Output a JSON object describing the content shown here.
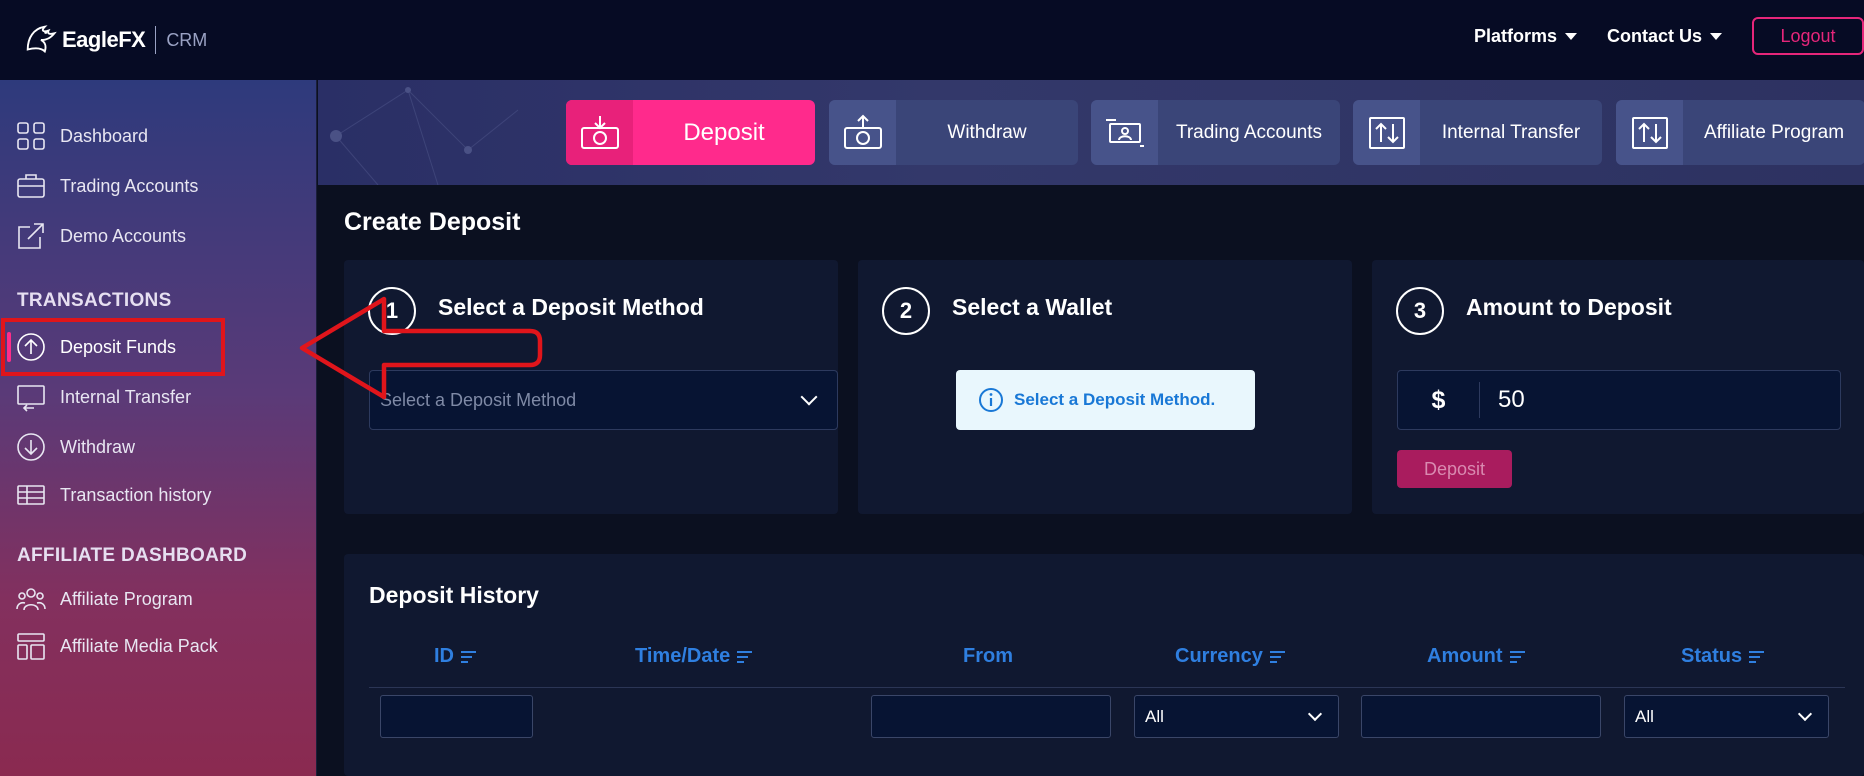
{
  "header": {
    "logo_text": "EagleFX",
    "logo_suffix": "CRM",
    "nav": [
      {
        "label": "Platforms"
      },
      {
        "label": "Contact Us"
      }
    ],
    "logout_label": "Logout"
  },
  "sidebar": {
    "items_top": [
      {
        "label": "Dashboard",
        "icon": "grid-icon"
      },
      {
        "label": "Trading Accounts",
        "icon": "briefcase-icon"
      },
      {
        "label": "Demo Accounts",
        "icon": "share-out-icon"
      }
    ],
    "transactions_heading": "TRANSACTIONS",
    "transactions": [
      {
        "label": "Deposit Funds",
        "icon": "arrow-up-circle-icon",
        "active": true
      },
      {
        "label": "Internal Transfer",
        "icon": "transfer-icon"
      },
      {
        "label": "Withdraw",
        "icon": "arrow-down-circle-icon"
      },
      {
        "label": "Transaction history",
        "icon": "table-icon"
      }
    ],
    "affiliate_heading": "AFFILIATE DASHBOARD",
    "affiliate": [
      {
        "label": "Affiliate Program",
        "icon": "users-icon"
      },
      {
        "label": "Affiliate Media Pack",
        "icon": "layout-icon"
      }
    ]
  },
  "tabs": [
    {
      "label": "Deposit",
      "active": true
    },
    {
      "label": "Withdraw"
    },
    {
      "label": "Trading Accounts"
    },
    {
      "label": "Internal Transfer"
    },
    {
      "label": "Affiliate Program"
    }
  ],
  "main": {
    "title": "Create Deposit",
    "steps": [
      {
        "number": "1",
        "title": "Select a Deposit Method",
        "select_placeholder": "Select a Deposit Method"
      },
      {
        "number": "2",
        "title": "Select a Wallet",
        "info": "Select a Deposit Method."
      },
      {
        "number": "3",
        "title": "Amount to Deposit",
        "currency": "$",
        "amount": "50",
        "button": "Deposit"
      }
    ]
  },
  "history": {
    "title": "Deposit History",
    "columns": [
      "ID",
      "Time/Date",
      "From",
      "Currency",
      "Amount",
      "Status"
    ],
    "currency_filter": "All",
    "status_filter": "All"
  },
  "colors": {
    "accent": "#ff2a8c",
    "link_blue": "#2f7fe0",
    "annotation_red": "#e0151b"
  }
}
